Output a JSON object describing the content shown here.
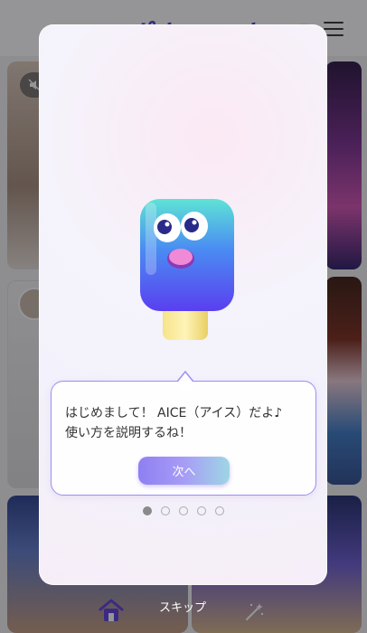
{
  "app": {
    "logo_text": "ポキャモキ AI"
  },
  "tutorial": {
    "message_line1": "はじめまして！ AICE（アイス）だよ♪",
    "message_line2": "使い方を説明するね！",
    "next_label": "次へ",
    "skip_label": "スキップ",
    "pages_total": 5,
    "current_page": 1
  },
  "colors": {
    "accent": "#8f7ff2",
    "bubble_border": "#9b8ff0",
    "logo": "#4b3bd6"
  },
  "icons": {
    "menu": "hamburger-menu-icon",
    "mute": "mute-icon",
    "home": "home-icon",
    "magic": "magic-wand-icon",
    "mascot": "aice-mascot"
  }
}
